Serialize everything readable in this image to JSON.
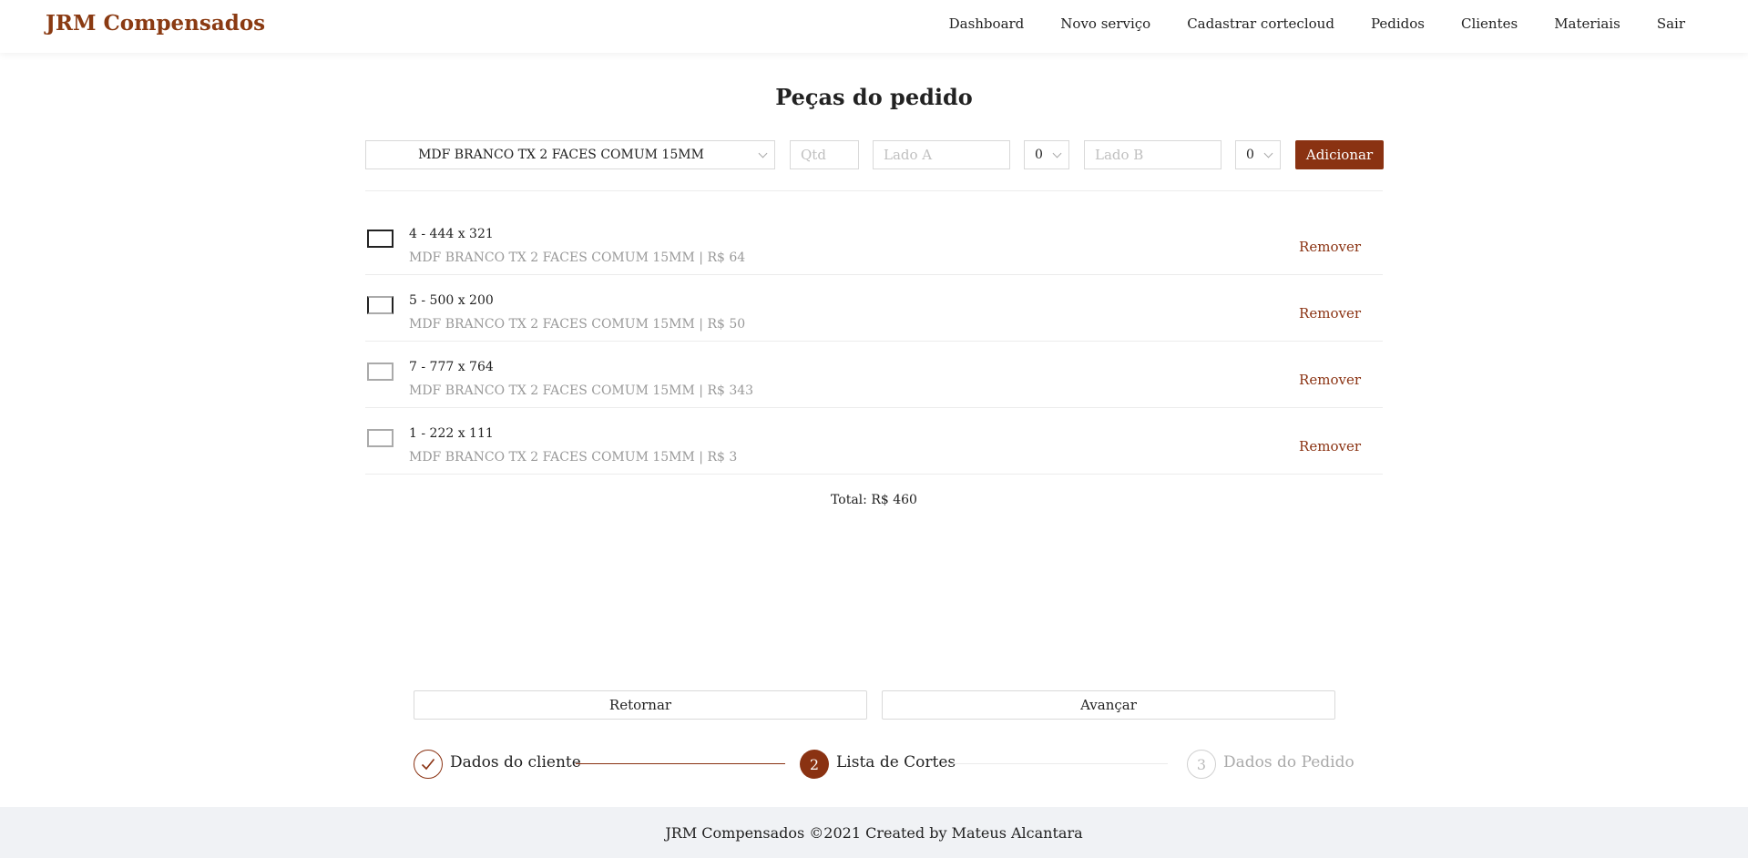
{
  "brand": "JRM Compensados",
  "nav": {
    "items": [
      "Dashboard",
      "Novo serviço",
      "Cadastrar cortecloud",
      "Pedidos",
      "Clientes",
      "Materiais",
      "Sair"
    ]
  },
  "page_title": "Peças do pedido",
  "form": {
    "material_selected": "MDF BRANCO TX 2 FACES COMUM 15MM",
    "qtd_placeholder": "Qtd",
    "lado_a_placeholder": "Lado A",
    "lado_a_edge_selected": "0",
    "lado_b_placeholder": "Lado B",
    "lado_b_edge_selected": "0",
    "add_label": "Adicionar"
  },
  "pieces": [
    {
      "title": "4 - 444 x 321",
      "desc": "MDF BRANCO TX 2 FACES COMUM 15MM | R$ 64",
      "remove_label": "Remover"
    },
    {
      "title": "5 - 500 x 200",
      "desc": "MDF BRANCO TX 2 FACES COMUM 15MM | R$ 50",
      "remove_label": "Remover"
    },
    {
      "title": "7 - 777 x 764",
      "desc": "MDF BRANCO TX 2 FACES COMUM 15MM | R$ 343",
      "remove_label": "Remover"
    },
    {
      "title": "1 - 222 x 111",
      "desc": "MDF BRANCO TX 2 FACES COMUM 15MM | R$ 3",
      "remove_label": "Remover"
    }
  ],
  "total": "Total: R$ 460",
  "actions": {
    "back_label": "Retornar",
    "next_label": "Avançar"
  },
  "steps": [
    {
      "label": "Dados do cliente",
      "status": "finished",
      "icon": "check-icon"
    },
    {
      "label": "Lista de Cortes",
      "status": "current",
      "number": "2"
    },
    {
      "label": "Dados do Pedido",
      "status": "waiting",
      "number": "3"
    }
  ],
  "footer": "JRM Compensados ©2021 Created by Mateus Alcantara",
  "colors": {
    "brand": "#8a3a12",
    "accent": "#8a3212",
    "muted": "#999999",
    "footer_bg": "#f0f2f5"
  }
}
